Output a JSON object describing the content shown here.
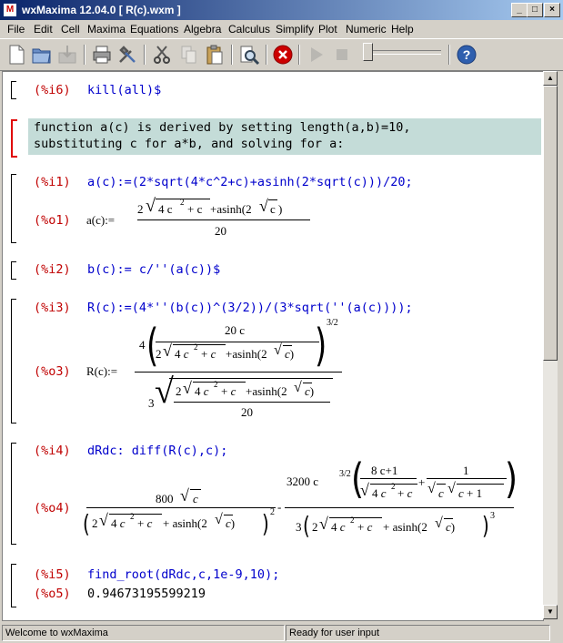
{
  "window": {
    "title": "wxMaxima 12.04.0  [ R(c).wxm ]",
    "controls": [
      "_",
      "□",
      "×"
    ]
  },
  "menu": [
    "File",
    "Edit",
    "Cell",
    "Maxima",
    "Equations",
    "Algebra",
    "Calculus",
    "Simplify",
    "Plot",
    "Numeric",
    "Help"
  ],
  "toolbar": {
    "buttons": [
      "new-icon",
      "open-icon",
      "save-icon",
      "print-icon",
      "settings-icon",
      "cut-icon",
      "copy-icon",
      "paste-icon",
      "find-icon",
      "interrupt-icon",
      "play-icon",
      "stop-icon",
      "help-icon"
    ],
    "interrupt_color": "#cc0000"
  },
  "cells": {
    "i6": {
      "label": "(%i6)",
      "input": "kill(all)$"
    },
    "text": {
      "line1": "function a(c) is derived by setting length(a,b)=10,",
      "line2": "substituting c for a*b, and solving for a:"
    },
    "i1": {
      "label": "(%i1)",
      "input": "a(c):=(2*sqrt(4*c^2+c)+asinh(2*sqrt(c)))/20;"
    },
    "o1": {
      "label": "(%o1)",
      "lhs": "a(c):=",
      "num_prefix": "2",
      "num_inner": "4 c",
      "num_exp": "2",
      "num_plus_c": "+ c",
      "num_asinh": "+asinh(2",
      "num_c": "c",
      "num_close": ")",
      "den": "20"
    },
    "i2": {
      "label": "(%i2)",
      "input": "b(c):= c/''(a(c))$"
    },
    "i3": {
      "label": "(%i3)",
      "input": "R(c):=(4*''(b(c))^(3/2))/(3*sqrt(''(a(c))));"
    },
    "o3": {
      "label": "(%o3)",
      "lhs": "R(c):=",
      "four": "4",
      "twenty_c": "20 c",
      "three_half": "3/2",
      "three": "3",
      "twenty": "20"
    },
    "i4": {
      "label": "(%i4)",
      "input": "dRdc: diff(R(c),c);"
    },
    "o4": {
      "label": "(%o4)",
      "t1_num": "800",
      "t2_num": "3200 c",
      "t2_exp": "3/2",
      "eight_c": "8 c+1",
      "one": "1",
      "minus": "-",
      "three": "3",
      "exp2": "2",
      "exp3": "3"
    },
    "i5": {
      "label": "(%i5)",
      "input": "find_root(dRdc,c,1e-9,10);"
    },
    "o5": {
      "label": "(%o5)",
      "output": "0.94673195599219"
    }
  },
  "status": {
    "left": "Welcome to wxMaxima",
    "right": "Ready for user input"
  }
}
